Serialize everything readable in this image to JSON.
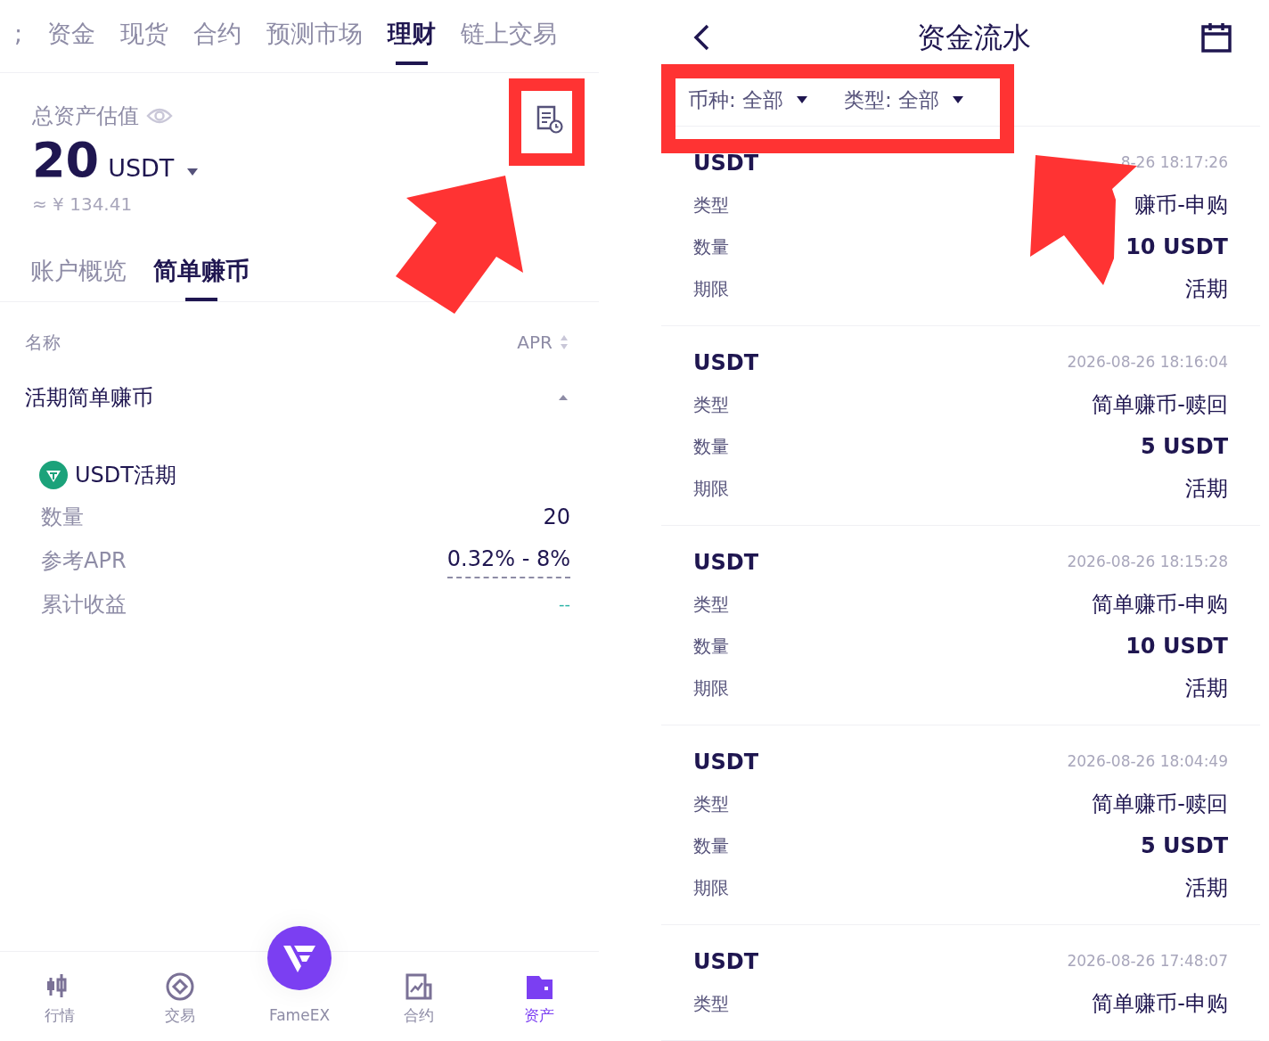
{
  "left": {
    "top_tabs": [
      {
        "label": ";",
        "selected": false
      },
      {
        "label": "资金",
        "selected": false
      },
      {
        "label": "现货",
        "selected": false
      },
      {
        "label": "合约",
        "selected": false
      },
      {
        "label": "预测市场",
        "selected": false
      },
      {
        "label": "理财",
        "selected": true
      },
      {
        "label": "链上交易",
        "selected": false
      }
    ],
    "summary": {
      "label": "总资产估值",
      "amount": "20",
      "unit": "USDT",
      "fiat": "≈ ¥ 134.41"
    },
    "sub_tabs": [
      {
        "label": "账户概览",
        "selected": false
      },
      {
        "label": "简单赚币",
        "selected": true
      }
    ],
    "list_header": {
      "name": "名称",
      "apr": "APR"
    },
    "group": {
      "title": "活期简单赚币",
      "expanded": true
    },
    "product": {
      "name": "USDT活期",
      "rows": [
        {
          "label": "数量",
          "value": "20",
          "kind": "plain"
        },
        {
          "label": "参考APR",
          "value": "0.32% - 8%",
          "kind": "dashed"
        },
        {
          "label": "累计收益",
          "value": "--",
          "kind": "empty"
        }
      ]
    },
    "bottom_nav": [
      {
        "label": "行情",
        "kind": "market",
        "selected": false
      },
      {
        "label": "交易",
        "kind": "trade",
        "selected": false
      },
      {
        "label": "FameEX",
        "kind": "center",
        "selected": false
      },
      {
        "label": "合约",
        "kind": "futures",
        "selected": false
      },
      {
        "label": "资产",
        "kind": "assets",
        "selected": true
      }
    ]
  },
  "right": {
    "header": {
      "title": "资金流水"
    },
    "filters": [
      {
        "label": "币种: 全部"
      },
      {
        "label": "类型: 全部"
      }
    ],
    "records": [
      {
        "coin": "USDT",
        "time": "8-26 18:17:26",
        "rows": [
          {
            "label": "类型",
            "value": "赚币-申购",
            "kind": "text"
          },
          {
            "label": "数量",
            "value": "10 USDT",
            "kind": "amount"
          },
          {
            "label": "期限",
            "value": "活期",
            "kind": "text"
          }
        ]
      },
      {
        "coin": "USDT",
        "time": "2026-08-26 18:16:04",
        "rows": [
          {
            "label": "类型",
            "value": "简单赚币-赎回",
            "kind": "text"
          },
          {
            "label": "数量",
            "value": "5 USDT",
            "kind": "amount"
          },
          {
            "label": "期限",
            "value": "活期",
            "kind": "text"
          }
        ]
      },
      {
        "coin": "USDT",
        "time": "2026-08-26 18:15:28",
        "rows": [
          {
            "label": "类型",
            "value": "简单赚币-申购",
            "kind": "text"
          },
          {
            "label": "数量",
            "value": "10 USDT",
            "kind": "amount"
          },
          {
            "label": "期限",
            "value": "活期",
            "kind": "text"
          }
        ]
      },
      {
        "coin": "USDT",
        "time": "2026-08-26 18:04:49",
        "rows": [
          {
            "label": "类型",
            "value": "简单赚币-赎回",
            "kind": "text"
          },
          {
            "label": "数量",
            "value": "5 USDT",
            "kind": "amount"
          },
          {
            "label": "期限",
            "value": "活期",
            "kind": "text"
          }
        ]
      },
      {
        "coin": "USDT",
        "time": "2026-08-26 17:48:07",
        "rows": [
          {
            "label": "类型",
            "value": "简单赚币-申购",
            "kind": "text"
          }
        ]
      }
    ]
  }
}
